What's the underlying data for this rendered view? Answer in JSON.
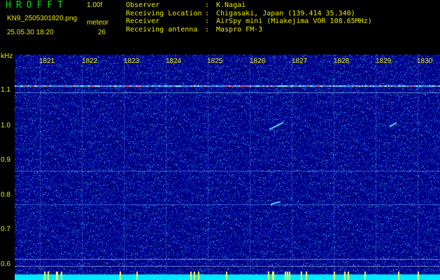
{
  "header": {
    "app_title": "HROFFT",
    "version": "1.00f",
    "filename": "KN9_2505301820.png",
    "mode": "meteor",
    "timestamp": "25.05.30 18:20",
    "count": "26",
    "meta": [
      {
        "key": "Observer",
        "sep": ":",
        "value": "K.Nagai"
      },
      {
        "key": "Receiving Location",
        "sep": ":",
        "value": "Chigasaki, Japan (139.414 35.340)"
      },
      {
        "key": "Receiver",
        "sep": ":",
        "value": "AirSpy mini (Miakejima VOR 108.65MHz)"
      },
      {
        "key": "Receiving antenna",
        "sep": ":",
        "value": "Maspro FM-3"
      }
    ]
  },
  "axes": {
    "y_unit": "kHz",
    "x_ticks": [
      "1821",
      "1822",
      "1823",
      "1824",
      "1825",
      "1826",
      "1827",
      "1828",
      "1829",
      "1830"
    ],
    "y_ticks": [
      "1.1",
      "1.0",
      "0.9",
      "0.8",
      "0.7",
      "0.6"
    ]
  },
  "colors": {
    "background": "#000000",
    "label": "#e8e800",
    "title": "#00e000",
    "spectrum_base": "#00008c",
    "baseline_band": "#00e8ff"
  }
}
